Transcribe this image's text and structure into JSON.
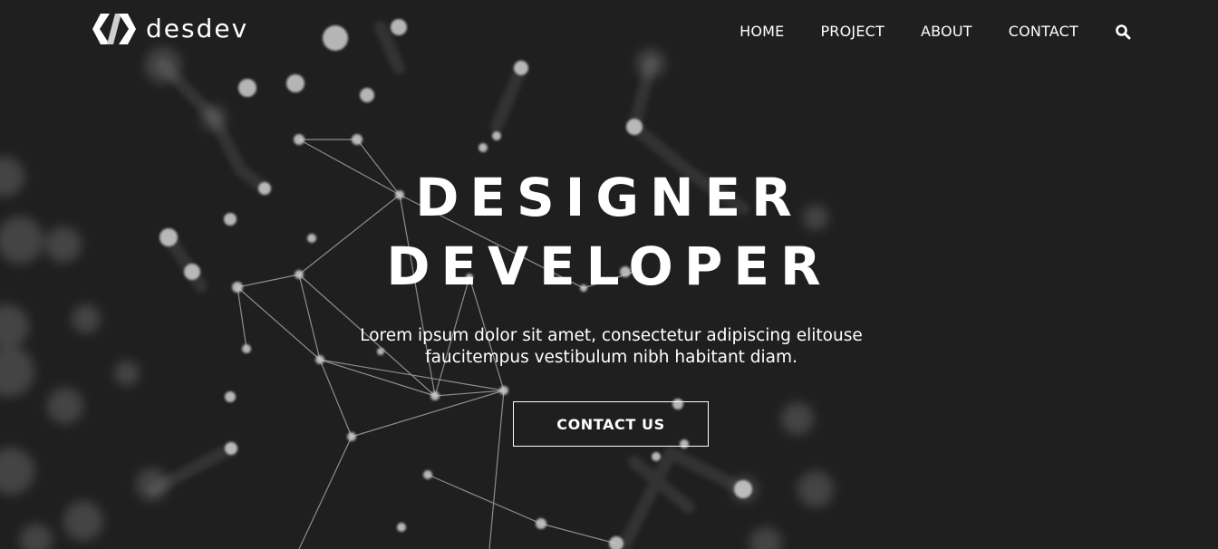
{
  "brand": {
    "name": "desdev",
    "logo_icon": "chevron-code-logo-icon"
  },
  "nav": {
    "items": [
      {
        "label": "HOME"
      },
      {
        "label": "PROJECT"
      },
      {
        "label": "ABOUT"
      },
      {
        "label": "CONTACT"
      }
    ],
    "search_icon": "search-icon"
  },
  "hero": {
    "headline_line1": "DESIGNER",
    "headline_line2": "DEVELOPER",
    "subtitle": "Lorem ipsum dolor sit amet, consectetur adipiscing elitouse faucitempus vestibulum nibh habitant diam.",
    "cta_label": "CONTACT US"
  },
  "colors": {
    "background": "#1f1f1f",
    "text": "#ffffff",
    "network": "#bdbdbd"
  }
}
